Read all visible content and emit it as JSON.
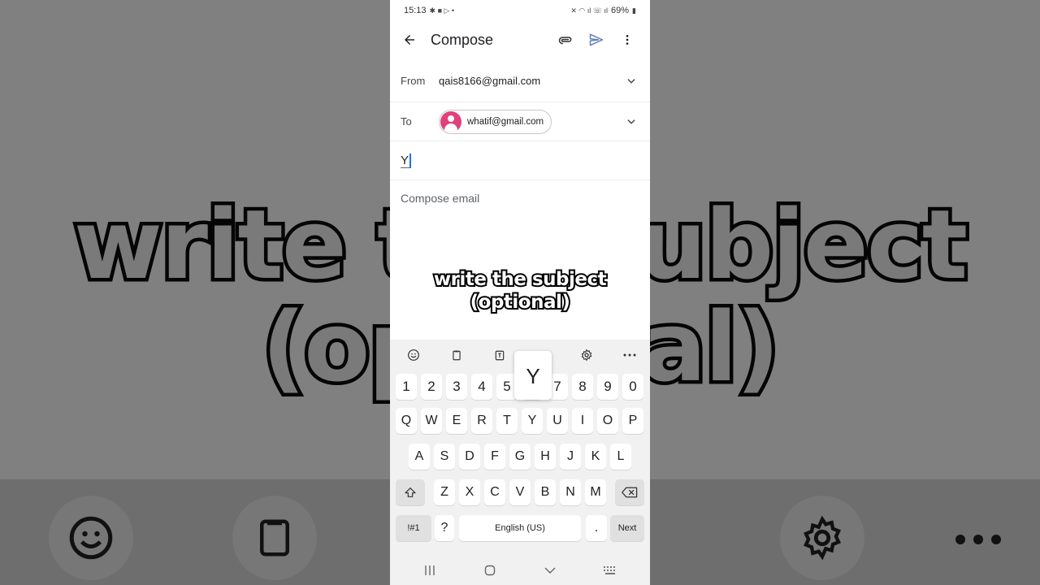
{
  "background": {
    "caption_line1": "write the subject",
    "caption_line2": "(optional)",
    "icons": [
      "smiley-icon",
      "clipboard-icon",
      "settings-icon",
      "more-icon"
    ]
  },
  "status_bar": {
    "time": "15:13",
    "battery": "69%"
  },
  "app_bar": {
    "title": "Compose",
    "icons": [
      "back-arrow-icon",
      "attach-icon",
      "send-icon",
      "more-vert-icon"
    ]
  },
  "from": {
    "label": "From",
    "value": "qais8166@gmail.com"
  },
  "to": {
    "label": "To",
    "recipient": "whatif@gmail.com"
  },
  "subject": {
    "value": "Y"
  },
  "body": {
    "placeholder": "Compose email"
  },
  "caption": {
    "line1": "write the subject",
    "line2": "(optional)"
  },
  "keyboard": {
    "popup_key": "Y",
    "number_row": [
      "1",
      "2",
      "3",
      "4",
      "5",
      "6",
      "7",
      "8",
      "9",
      "0"
    ],
    "row1": [
      "Q",
      "W",
      "E",
      "R",
      "T",
      "Y",
      "U",
      "I",
      "O",
      "P"
    ],
    "row2": [
      "A",
      "S",
      "D",
      "F",
      "G",
      "H",
      "J",
      "K",
      "L"
    ],
    "row3": [
      "Z",
      "X",
      "C",
      "V",
      "B",
      "N",
      "M"
    ],
    "symbols_key": "!#1",
    "question_key": "?",
    "space_label": "English (US)",
    "period_key": ".",
    "next_key": "Next"
  },
  "colors": {
    "accent": "#1a73e8",
    "avatar": "#e2407a",
    "send": "#5f7fb8"
  }
}
